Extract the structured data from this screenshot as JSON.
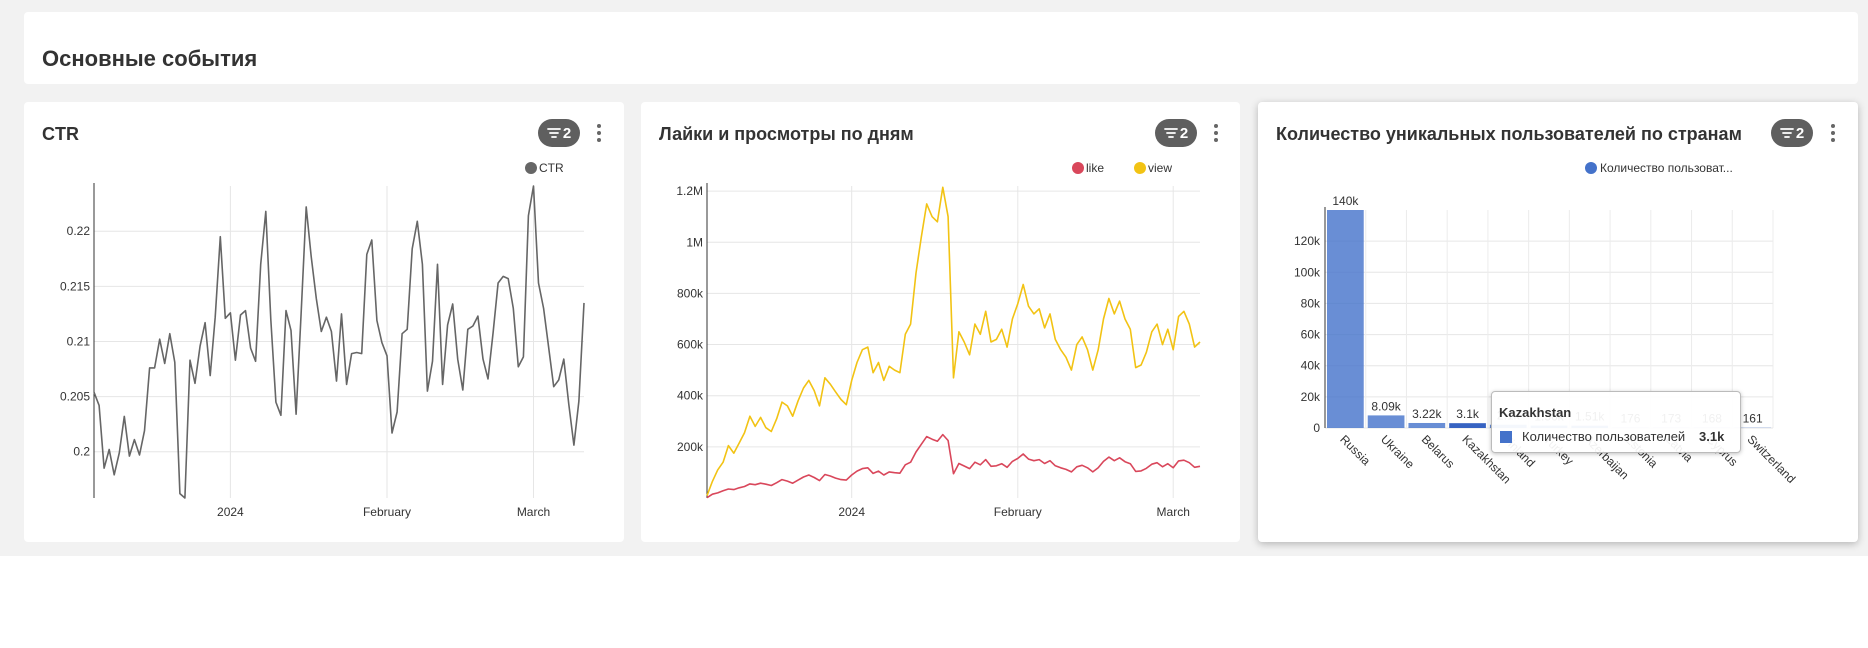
{
  "page": {
    "title": "Основные события"
  },
  "cards": [
    {
      "title": "CTR",
      "filter_count": "2"
    },
    {
      "title": "Лайки и просмотры по дням",
      "filter_count": "2"
    },
    {
      "title": "Количество уникальных пользователей по странам",
      "filter_count": "2"
    }
  ],
  "icons": {
    "filter": "filter-icon",
    "menu": "kebab-menu-icon"
  },
  "colors": {
    "ctr": "#666666",
    "like": "#d9475b",
    "view": "#f2c314",
    "users": "#4472ca"
  },
  "chart_data": [
    {
      "type": "line",
      "legend": [
        "CTR"
      ],
      "x_ticks": [
        "2024",
        "February",
        "March"
      ],
      "y_ticks": [
        "0.2",
        "0.205",
        "0.21",
        "0.215",
        "0.22"
      ],
      "ylim": [
        0.1958,
        0.2241
      ],
      "x_start": "2023-12-05",
      "series": [
        {
          "name": "CTR",
          "values": [
            0.2054,
            0.2042,
            0.1985,
            0.2002,
            0.1979,
            0.1999,
            0.2032,
            0.1996,
            0.2011,
            0.1997,
            0.2019,
            0.2076,
            0.2076,
            0.2102,
            0.208,
            0.2107,
            0.2081,
            0.1962,
            0.1958,
            0.2083,
            0.2062,
            0.2096,
            0.2117,
            0.2069,
            0.2122,
            0.2195,
            0.2121,
            0.2126,
            0.2083,
            0.2124,
            0.2128,
            0.2094,
            0.2082,
            0.217,
            0.2218,
            0.212,
            0.2045,
            0.2033,
            0.2128,
            0.211,
            0.2034,
            0.2125,
            0.2222,
            0.2177,
            0.2139,
            0.2109,
            0.2122,
            0.2109,
            0.2064,
            0.2125,
            0.2061,
            0.2089,
            0.209,
            0.2089,
            0.2179,
            0.2192,
            0.2119,
            0.2099,
            0.2087,
            0.2017,
            0.2036,
            0.2107,
            0.2111,
            0.2184,
            0.2209,
            0.217,
            0.2055,
            0.2082,
            0.217,
            0.2061,
            0.2115,
            0.2134,
            0.2084,
            0.2056,
            0.2111,
            0.2114,
            0.2123,
            0.2084,
            0.2066,
            0.2108,
            0.2153,
            0.2159,
            0.2157,
            0.213,
            0.2077,
            0.2086,
            0.2214,
            0.2241,
            0.2153,
            0.213,
            0.2095,
            0.2059,
            0.2065,
            0.2084,
            0.2043,
            0.2006,
            0.2046,
            0.2135
          ]
        }
      ]
    },
    {
      "type": "line",
      "legend": [
        "like",
        "view"
      ],
      "x_ticks": [
        "2024",
        "February",
        "March"
      ],
      "y_ticks": [
        "200k",
        "400k",
        "600k",
        "800k",
        "1M",
        "1.2M"
      ],
      "ylim": [
        0,
        1220000
      ],
      "x_start": "2023-12-05",
      "series": [
        {
          "name": "view",
          "values": [
            9000,
            65000,
            110000,
            140000,
            205000,
            175000,
            215000,
            255000,
            320000,
            280000,
            315000,
            275000,
            260000,
            310000,
            375000,
            360000,
            320000,
            380000,
            430000,
            460000,
            420000,
            360000,
            470000,
            445000,
            415000,
            385000,
            365000,
            460000,
            530000,
            580000,
            590000,
            490000,
            530000,
            460000,
            515000,
            500000,
            490000,
            640000,
            680000,
            880000,
            1020000,
            1150000,
            1100000,
            1080000,
            1215000,
            1100000,
            470000,
            650000,
            610000,
            560000,
            680000,
            640000,
            730000,
            610000,
            620000,
            660000,
            590000,
            700000,
            760000,
            835000,
            750000,
            720000,
            740000,
            665000,
            720000,
            620000,
            580000,
            550000,
            500000,
            600000,
            630000,
            580000,
            500000,
            580000,
            700000,
            780000,
            720000,
            770000,
            700000,
            660000,
            510000,
            520000,
            570000,
            650000,
            680000,
            600000,
            660000,
            580000,
            710000,
            730000,
            680000,
            590000,
            610000
          ]
        },
        {
          "name": "like",
          "values": [
            1000,
            15000,
            20000,
            28000,
            35000,
            33000,
            40000,
            45000,
            55000,
            52000,
            58000,
            54000,
            49000,
            60000,
            72000,
            66000,
            58000,
            70000,
            82000,
            90000,
            80000,
            68000,
            92000,
            86000,
            78000,
            72000,
            70000,
            90000,
            105000,
            115000,
            118000,
            96000,
            105000,
            90000,
            102000,
            99000,
            97000,
            130000,
            140000,
            180000,
            210000,
            240000,
            230000,
            222000,
            248000,
            225000,
            95000,
            135000,
            125000,
            115000,
            140000,
            130000,
            150000,
            124000,
            126000,
            134000,
            120000,
            143000,
            155000,
            172000,
            152000,
            146000,
            150000,
            135000,
            146000,
            126000,
            118000,
            112000,
            102000,
            122000,
            128000,
            118000,
            102000,
            118000,
            143000,
            160000,
            146000,
            157000,
            142000,
            134000,
            104000,
            106000,
            116000,
            132000,
            138000,
            122000,
            134000,
            118000,
            145000,
            148000,
            138000,
            120000,
            124000
          ]
        }
      ]
    },
    {
      "type": "bar",
      "legend": [
        "Количество пользоват..."
      ],
      "categories": [
        "Russia",
        "Ukraine",
        "Belarus",
        "Kazakhstan",
        "Finland",
        "Turkey",
        "Azerbaijan",
        "Estonia",
        "Latvia",
        "Cyprus",
        "Switzerland"
      ],
      "values": [
        140000,
        8090,
        3220,
        3100,
        2100,
        1560,
        1510,
        176,
        173,
        168,
        161
      ],
      "data_labels": [
        "140k",
        "8.09k",
        "3.22k",
        "3.1k",
        "2.1k",
        "1.56k",
        "1.51k",
        "176",
        "173",
        "168",
        "161"
      ],
      "y_ticks": [
        "0",
        "20k",
        "40k",
        "60k",
        "80k",
        "100k",
        "120k"
      ],
      "ylim": [
        0,
        140000
      ],
      "highlighted": "Kazakhstan"
    }
  ],
  "tooltip": {
    "title": "Kazakhstan",
    "label": "Количество пользователей",
    "value": "3.1k"
  }
}
